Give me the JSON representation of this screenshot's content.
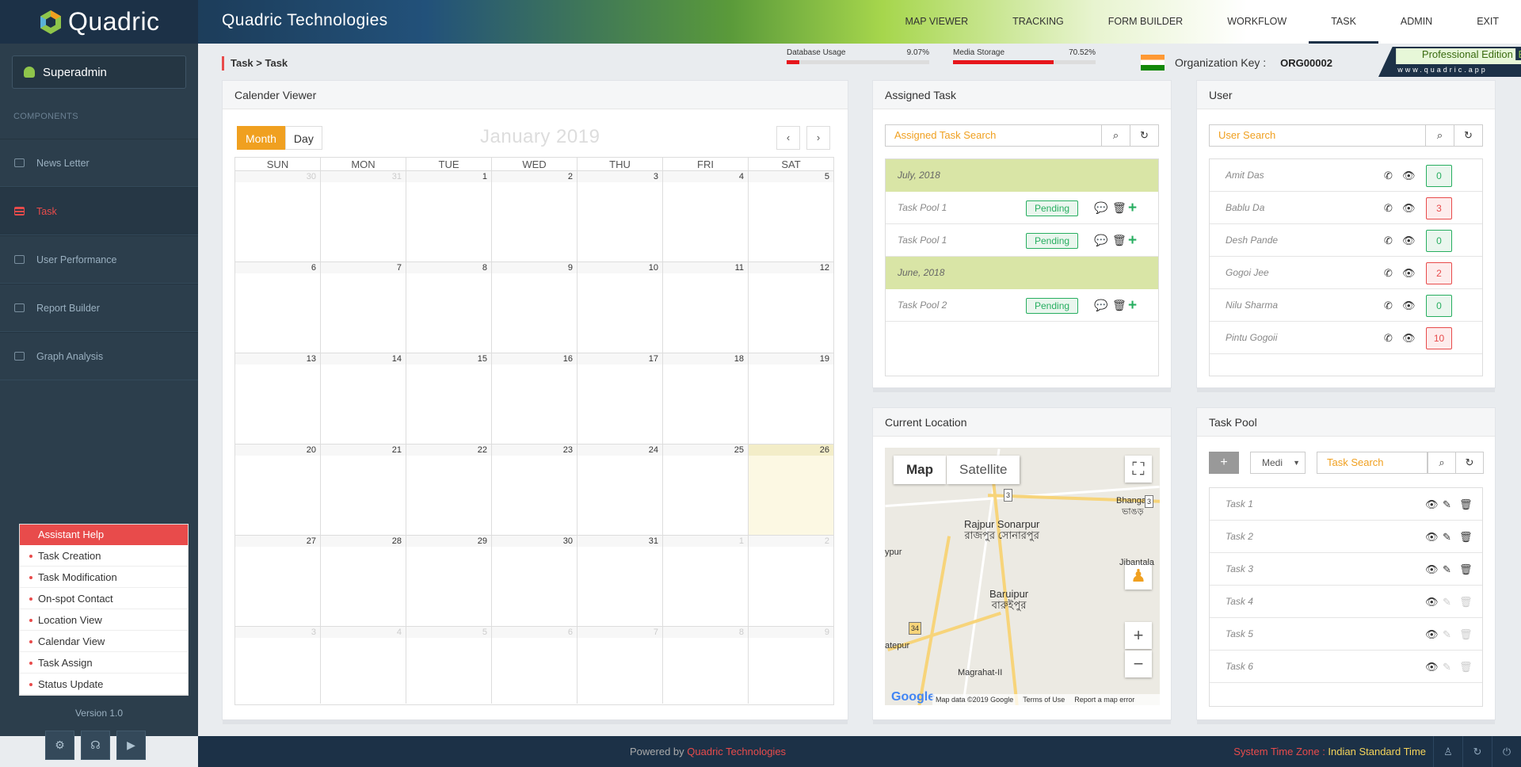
{
  "app": {
    "logo_text": "Quadric",
    "org_title": "Quadric Technologies"
  },
  "topnav": [
    "MAP VIEWER",
    "TRACKING",
    "FORM BUILDER",
    "WORKFLOW",
    "TASK",
    "ADMIN",
    "EXIT"
  ],
  "active_nav": "TASK",
  "sidebar": {
    "user": "Superadmin",
    "section_label": "COMPONENTS",
    "items": [
      {
        "label": "News Letter",
        "active": false
      },
      {
        "label": "Task",
        "active": true
      },
      {
        "label": "User Performance",
        "active": false
      },
      {
        "label": "Report Builder",
        "active": false
      },
      {
        "label": "Graph Analysis",
        "active": false
      }
    ],
    "assistant": {
      "title": "Assistant Help",
      "items": [
        "Task Creation",
        "Task Modification",
        "On-spot Contact",
        "Location View",
        "Calendar View",
        "Task Assign",
        "Status Update"
      ]
    },
    "version": "Version 1.0"
  },
  "subbar": {
    "breadcrumb": "Task > Task",
    "db_usage": {
      "label": "Database Usage",
      "value": "9.07%",
      "fraction": 0.0907
    },
    "media_storage": {
      "label": "Media Storage",
      "value": "70.52%",
      "fraction": 0.7052
    },
    "org_key_label": "Organization Key :",
    "org_key_value": "ORG00002",
    "edition": "Professional Edition",
    "edition_badge": "E",
    "website": "www.quadric.app"
  },
  "calendar": {
    "panel_title": "Calender Viewer",
    "view_month": "Month",
    "view_day": "Day",
    "title": "January 2019",
    "prev": "‹",
    "next": "›",
    "weekdays": [
      "SUN",
      "MON",
      "TUE",
      "WED",
      "THU",
      "FRI",
      "SAT"
    ],
    "weeks": [
      [
        "30",
        "31",
        "1",
        "2",
        "3",
        "4",
        "5"
      ],
      [
        "6",
        "7",
        "8",
        "9",
        "10",
        "11",
        "12"
      ],
      [
        "13",
        "14",
        "15",
        "16",
        "17",
        "18",
        "19"
      ],
      [
        "20",
        "21",
        "22",
        "23",
        "24",
        "25",
        "26"
      ],
      [
        "27",
        "28",
        "29",
        "30",
        "31",
        "1",
        "2"
      ],
      [
        "3",
        "4",
        "5",
        "6",
        "7",
        "8",
        "9"
      ]
    ],
    "today": "26"
  },
  "assigned": {
    "panel_title": "Assigned Task",
    "search_placeholder": "Assigned Task Search",
    "groups": [
      {
        "month": "July, 2018",
        "tasks": [
          {
            "name": "Task Pool 1",
            "status": "Pending"
          },
          {
            "name": "Task Pool 1",
            "status": "Pending"
          }
        ]
      },
      {
        "month": "June, 2018",
        "tasks": [
          {
            "name": "Task Pool 2",
            "status": "Pending"
          }
        ]
      }
    ]
  },
  "users": {
    "panel_title": "User",
    "search_placeholder": "User Search",
    "list": [
      {
        "name": "Amit Das",
        "count": "0",
        "alert": false
      },
      {
        "name": "Bablu Da",
        "count": "3",
        "alert": true
      },
      {
        "name": "Desh Pande",
        "count": "0",
        "alert": false
      },
      {
        "name": "Gogoi Jee",
        "count": "2",
        "alert": true
      },
      {
        "name": "Nilu Sharma",
        "count": "0",
        "alert": false
      },
      {
        "name": "Pintu Gogoii",
        "count": "10",
        "alert": true
      }
    ]
  },
  "location": {
    "panel_title": "Current Location",
    "tab_map": "Map",
    "tab_satellite": "Satellite",
    "places": [
      "Rajpur Sonarpur",
      "রাজপুর সোনারপুর",
      "Baruipur",
      "বারুইপুর",
      "Bhangar",
      "ভাঙড়",
      "Jibantala",
      "Magrahat-II",
      "ypur",
      "atepur"
    ],
    "road_labels": [
      "3",
      "3",
      "34"
    ],
    "google": "Google",
    "footer": [
      "Map data ©2019 Google",
      "Terms of Use",
      "Report a map error"
    ]
  },
  "pool": {
    "panel_title": "Task Pool",
    "select_value": "Medi",
    "search_placeholder": "Task Search",
    "tasks": [
      {
        "name": "Task 1",
        "editable": true
      },
      {
        "name": "Task 2",
        "editable": true
      },
      {
        "name": "Task 3",
        "editable": true
      },
      {
        "name": "Task 4",
        "editable": false
      },
      {
        "name": "Task 5",
        "editable": false
      },
      {
        "name": "Task 6",
        "editable": false
      }
    ]
  },
  "footer": {
    "powered_prefix": "Powered by ",
    "powered_brand": "Quadric Technologies",
    "tz_label": "System Time Zone : ",
    "tz_value": "Indian Standard Time"
  }
}
